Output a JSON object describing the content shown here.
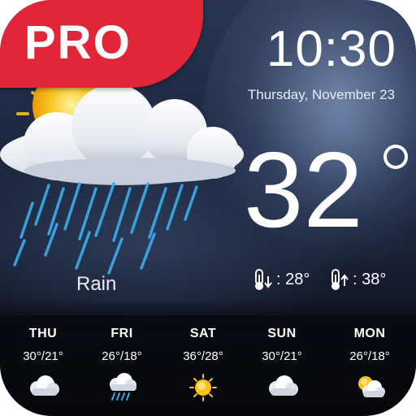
{
  "badge": {
    "label": "PRO"
  },
  "clock": {
    "time": "10:30",
    "date": "Thursday, November 23"
  },
  "current": {
    "temperature": "32",
    "condition": "Rain",
    "min_label": ": 28°",
    "max_label": ": 38°"
  },
  "forecast": [
    {
      "day": "THU",
      "temps": "30°/21°",
      "icon": "cloud-icon"
    },
    {
      "day": "FRI",
      "temps": "26°/18°",
      "icon": "rain-cloud-icon"
    },
    {
      "day": "SAT",
      "temps": "36°/28°",
      "icon": "sun-icon"
    },
    {
      "day": "SUN",
      "temps": "30°/21°",
      "icon": "cloud-icon"
    },
    {
      "day": "MON",
      "temps": "26°/18°",
      "icon": "sun-cloud-icon"
    }
  ],
  "colors": {
    "badge": "#e2263a",
    "text": "#ffffff",
    "rain": "#3aa7e6",
    "sun": "#f7c21a"
  }
}
